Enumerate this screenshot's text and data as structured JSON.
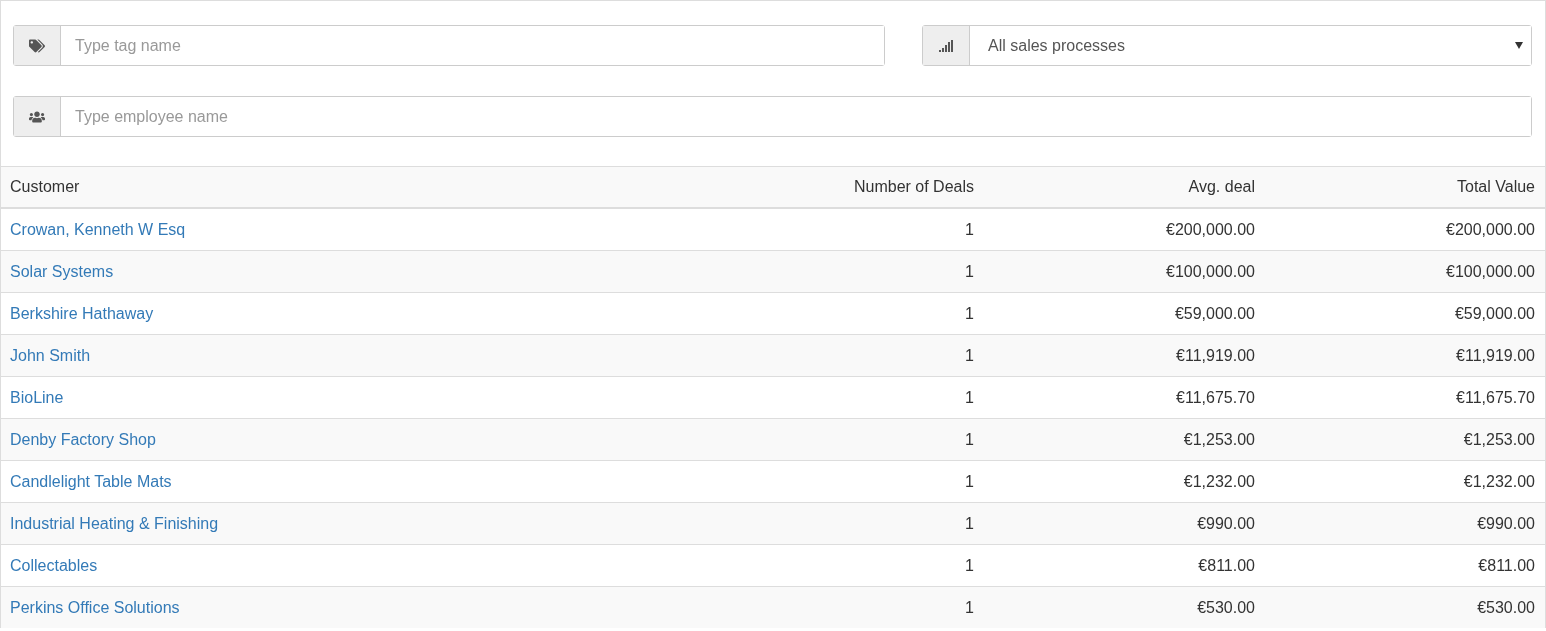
{
  "filters": {
    "tag": {
      "placeholder": "Type tag name"
    },
    "sales_process": {
      "value": "All sales processes"
    },
    "employee": {
      "placeholder": "Type employee name"
    }
  },
  "table": {
    "columns": [
      "Customer",
      "Number of Deals",
      "Avg. deal",
      "Total Value"
    ],
    "rows": [
      {
        "customer": "Crowan, Kenneth W Esq",
        "deals": "1",
        "avg": "€200,000.00",
        "total": "€200,000.00"
      },
      {
        "customer": "Solar Systems",
        "deals": "1",
        "avg": "€100,000.00",
        "total": "€100,000.00"
      },
      {
        "customer": "Berkshire Hathaway",
        "deals": "1",
        "avg": "€59,000.00",
        "total": "€59,000.00"
      },
      {
        "customer": "John Smith",
        "deals": "1",
        "avg": "€11,919.00",
        "total": "€11,919.00"
      },
      {
        "customer": "BioLine",
        "deals": "1",
        "avg": "€11,675.70",
        "total": "€11,675.70"
      },
      {
        "customer": "Denby Factory Shop",
        "deals": "1",
        "avg": "€1,253.00",
        "total": "€1,253.00"
      },
      {
        "customer": "Candlelight Table Mats",
        "deals": "1",
        "avg": "€1,232.00",
        "total": "€1,232.00"
      },
      {
        "customer": "Industrial Heating & Finishing",
        "deals": "1",
        "avg": "€990.00",
        "total": "€990.00"
      },
      {
        "customer": "Collectables",
        "deals": "1",
        "avg": "€811.00",
        "total": "€811.00"
      },
      {
        "customer": "Perkins Office Solutions",
        "deals": "1",
        "avg": "€530.00",
        "total": "€530.00"
      }
    ]
  }
}
